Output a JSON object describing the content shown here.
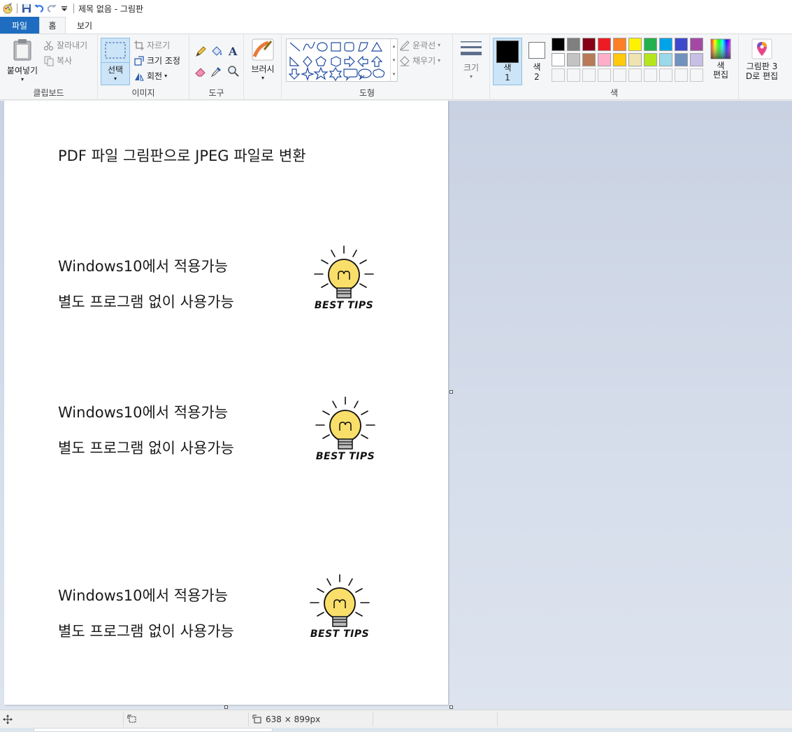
{
  "window": {
    "title": "제목 없음 - 그림판"
  },
  "tabs": {
    "file": "파일",
    "home": "홈",
    "view": "보기"
  },
  "clipboard": {
    "paste": "붙여넣기",
    "cut": "잘라내기",
    "copy": "복사",
    "label": "클립보드"
  },
  "image": {
    "select": "선택",
    "crop": "자르기",
    "resize": "크기 조정",
    "rotate": "회전",
    "label": "이미지"
  },
  "tools": {
    "label": "도구"
  },
  "brushes": {
    "label": "브러시"
  },
  "shapes": {
    "outline": "윤곽선",
    "fill": "채우기",
    "label": "도형"
  },
  "size": {
    "label": "크기"
  },
  "colors": {
    "color1_line1": "색",
    "color1_line2": "1",
    "color2_line1": "색",
    "color2_line2": "2",
    "edit_line1": "색",
    "edit_line2": "편집",
    "label": "색",
    "palette_row1": [
      "#000000",
      "#7f7f7f",
      "#880015",
      "#ed1c24",
      "#ff7f27",
      "#fff200",
      "#22b14c",
      "#00a2e8",
      "#3f48cc",
      "#a349a4"
    ],
    "palette_row2": [
      "#ffffff",
      "#c3c3c3",
      "#b97a57",
      "#ffaec9",
      "#ffc90e",
      "#efe4b0",
      "#b5e61d",
      "#99d9ea",
      "#7092be",
      "#c8bfe7"
    ]
  },
  "paint3d": {
    "line1": "그림판 3",
    "line2": "D로 편집"
  },
  "canvas": {
    "heading": "PDF 파일 그림판으로 JPEG 파일로 변환",
    "blocks": [
      {
        "line1": "Windows10에서 적용가능",
        "line2": "별도 프로그램 없이 사용가능",
        "badge": "BEST TIPS"
      },
      {
        "line1": "Windows10에서 적용가능",
        "line2": "별도 프로그램 없이 사용가능",
        "badge": "BEST TIPS"
      },
      {
        "line1": "Windows10에서 적용가능",
        "line2": "별도 프로그램 없이 사용가능",
        "badge": "BEST TIPS"
      }
    ]
  },
  "status": {
    "dimensions": "638 × 899px"
  }
}
